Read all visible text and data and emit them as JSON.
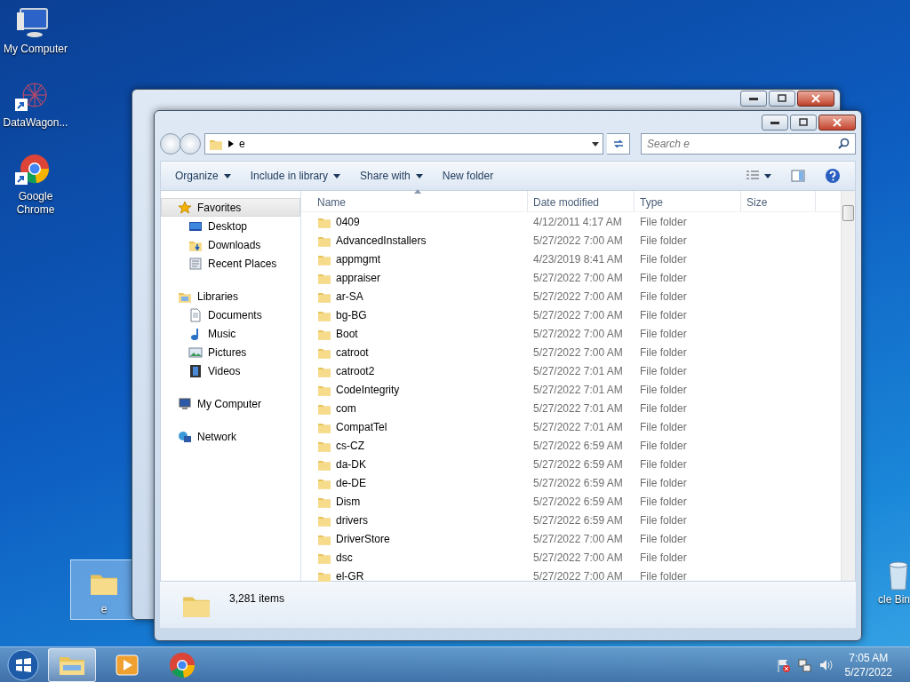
{
  "desktop_icons": [
    {
      "label": "My Computer",
      "kind": "computer",
      "shortcut": false
    },
    {
      "label": "DataWagon...",
      "kind": "web",
      "shortcut": true
    },
    {
      "label": "Google Chrome",
      "kind": "chrome",
      "shortcut": true
    }
  ],
  "dragged_icon": {
    "label": "e",
    "selected": true
  },
  "recycle_bin": {
    "label": "cle Bin"
  },
  "explorer": {
    "breadcrumb": [
      "e"
    ],
    "search": {
      "placeholder": "Search e"
    },
    "toolbar": [
      {
        "label": "Organize",
        "dropdown": true
      },
      {
        "label": "Include in library",
        "dropdown": true
      },
      {
        "label": "Share with",
        "dropdown": true
      },
      {
        "label": "New folder",
        "dropdown": false
      }
    ],
    "navigation": [
      {
        "label": "Favorites",
        "kind": "star",
        "selected": true,
        "children": [
          {
            "label": "Desktop",
            "kind": "desktop",
            "selected": false
          },
          {
            "label": "Downloads",
            "kind": "downloads",
            "selected": false
          },
          {
            "label": "Recent Places",
            "kind": "recent",
            "selected": false
          }
        ]
      },
      {
        "label": "Libraries",
        "kind": "libraries",
        "selected": false,
        "children": [
          {
            "label": "Documents",
            "kind": "documents",
            "selected": false
          },
          {
            "label": "Music",
            "kind": "music",
            "selected": false
          },
          {
            "label": "Pictures",
            "kind": "pictures",
            "selected": false
          },
          {
            "label": "Videos",
            "kind": "videos",
            "selected": false
          }
        ]
      },
      {
        "label": "My Computer",
        "kind": "computer",
        "selected": false
      },
      {
        "label": "Network",
        "kind": "network",
        "selected": false
      }
    ],
    "columns": [
      {
        "label": "Name",
        "sorted": true
      },
      {
        "label": "Date modified",
        "sorted": false
      },
      {
        "label": "Type",
        "sorted": false
      },
      {
        "label": "Size",
        "sorted": false
      }
    ],
    "rows": [
      {
        "name": "0409",
        "date": "4/12/2011 4:17 AM",
        "type": "File folder"
      },
      {
        "name": "AdvancedInstallers",
        "date": "5/27/2022 7:00 AM",
        "type": "File folder"
      },
      {
        "name": "appmgmt",
        "date": "4/23/2019 8:41 AM",
        "type": "File folder"
      },
      {
        "name": "appraiser",
        "date": "5/27/2022 7:00 AM",
        "type": "File folder"
      },
      {
        "name": "ar-SA",
        "date": "5/27/2022 7:00 AM",
        "type": "File folder"
      },
      {
        "name": "bg-BG",
        "date": "5/27/2022 7:00 AM",
        "type": "File folder"
      },
      {
        "name": "Boot",
        "date": "5/27/2022 7:00 AM",
        "type": "File folder"
      },
      {
        "name": "catroot",
        "date": "5/27/2022 7:00 AM",
        "type": "File folder"
      },
      {
        "name": "catroot2",
        "date": "5/27/2022 7:01 AM",
        "type": "File folder"
      },
      {
        "name": "CodeIntegrity",
        "date": "5/27/2022 7:01 AM",
        "type": "File folder"
      },
      {
        "name": "com",
        "date": "5/27/2022 7:01 AM",
        "type": "File folder"
      },
      {
        "name": "CompatTel",
        "date": "5/27/2022 7:01 AM",
        "type": "File folder"
      },
      {
        "name": "cs-CZ",
        "date": "5/27/2022 6:59 AM",
        "type": "File folder"
      },
      {
        "name": "da-DK",
        "date": "5/27/2022 6:59 AM",
        "type": "File folder"
      },
      {
        "name": "de-DE",
        "date": "5/27/2022 6:59 AM",
        "type": "File folder"
      },
      {
        "name": "Dism",
        "date": "5/27/2022 6:59 AM",
        "type": "File folder"
      },
      {
        "name": "drivers",
        "date": "5/27/2022 6:59 AM",
        "type": "File folder"
      },
      {
        "name": "DriverStore",
        "date": "5/27/2022 7:00 AM",
        "type": "File folder"
      },
      {
        "name": "dsc",
        "date": "5/27/2022 7:00 AM",
        "type": "File folder"
      },
      {
        "name": "el-GR",
        "date": "5/27/2022 7:00 AM",
        "type": "File folder"
      }
    ],
    "status": "3,281 items"
  },
  "taskbar": {
    "items": [
      {
        "kind": "explorer",
        "active": true
      },
      {
        "kind": "media",
        "active": false
      },
      {
        "kind": "chrome",
        "active": false
      }
    ],
    "clock": {
      "time": "7:05 AM",
      "date": "5/27/2022"
    }
  }
}
